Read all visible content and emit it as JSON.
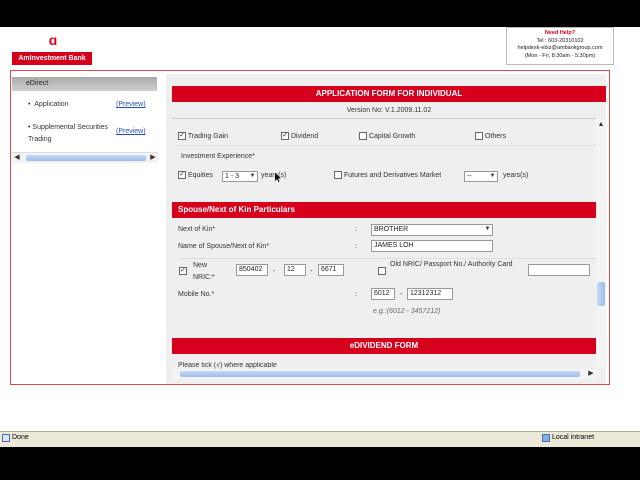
{
  "brand": {
    "logo_symbol": "ɑ",
    "name": "AmInvestment Bank",
    "color": "#d6001c"
  },
  "help": {
    "title": "Need Help?",
    "tel": "Tel : 603-20310102",
    "email": "helpdesk-ebiz@ambankgroup.com",
    "hours": "(Mon - Fri, 8:30am - 5:30pm)"
  },
  "sidebar": {
    "header": "eDirect",
    "items": [
      {
        "label": "Application",
        "preview": "(Preview)"
      },
      {
        "label": "Supplemental Securities Trading",
        "preview": "(Preview)"
      }
    ]
  },
  "form": {
    "title": "APPLICATION FORM FOR INDIVIDUAL",
    "version": "Version No: V.1.2009.11.02",
    "objectives": [
      {
        "label": "Trading Gain",
        "checked": true
      },
      {
        "label": "Dividend",
        "checked": true
      },
      {
        "label": "Capital Growth",
        "checked": false
      },
      {
        "label": "Others",
        "checked": false
      }
    ],
    "experience": {
      "label": "Investment Experience*",
      "equities": {
        "label": "Equities",
        "checked": true,
        "value": "1 - 3",
        "unit": "years(s)"
      },
      "futures": {
        "label": "Futures and Derivatives Market",
        "checked": false,
        "value": "--",
        "unit": "years(s)"
      }
    },
    "kin": {
      "section": "Spouse/Next of Kin Particulars",
      "next_of_kin_label": "Next of Kin*",
      "next_of_kin_value": "BROTHER",
      "name_label": "Name of Spouse/Next of Kin*",
      "name_value": "JAMES LOH",
      "new_nric_label": "New NRIC:*",
      "new_nric_checked": true,
      "nric": [
        "850402",
        "12",
        "6671"
      ],
      "old_nric_label": "Old NRIC/ Passport No./ Authority Card",
      "old_nric_checked": false,
      "old_nric_value": "",
      "mobile_label": "Mobile No.*",
      "mobile_prefix": "6012",
      "mobile_number": "12312312",
      "mobile_hint": "e.g.:(6012 - 3457212)",
      "colon": ":",
      "dash": "-"
    },
    "edividend": {
      "section": "eDIVIDEND FORM",
      "note": "Please tick (√) where applicable"
    }
  },
  "statusbar": {
    "left": "Done",
    "zone": "Local intranet"
  }
}
